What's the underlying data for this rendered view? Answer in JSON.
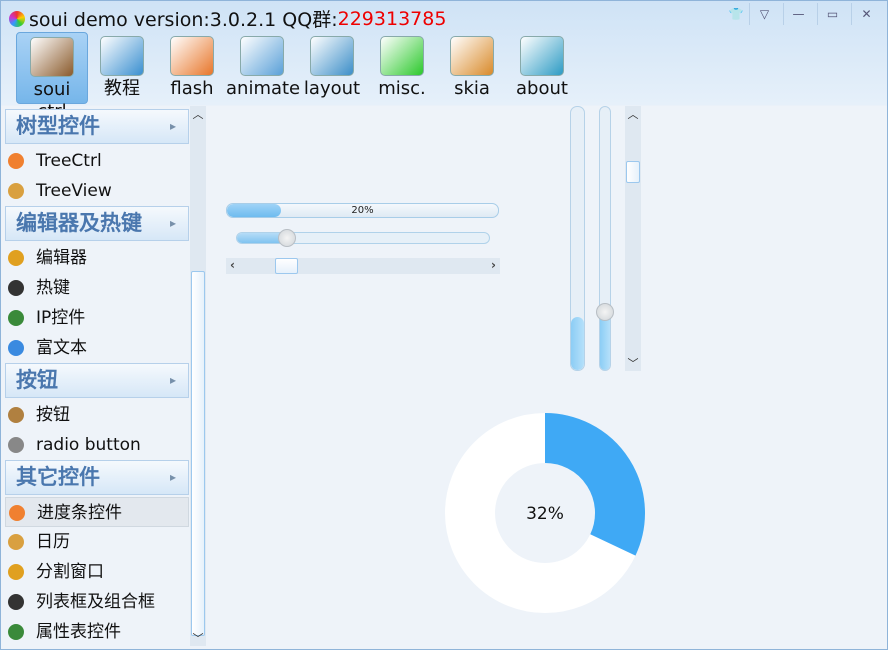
{
  "window": {
    "title": "soui demo version:3.0.2.1 QQ群:",
    "qq": "229313785",
    "controls": [
      "skin-icon",
      "menu-icon",
      "minimize-icon",
      "maximize-icon",
      "close-icon"
    ]
  },
  "toolbar": [
    {
      "label": "soui ctrl",
      "icon": "house-icon",
      "selected": true,
      "color": "#8a5a2b"
    },
    {
      "label": "教程",
      "icon": "cd-icon",
      "color": "#3a8fd0"
    },
    {
      "label": "flash",
      "icon": "flash-icon",
      "color": "#e8762a"
    },
    {
      "label": "animate",
      "icon": "news-icon",
      "color": "#5aa0d8"
    },
    {
      "label": "layout",
      "icon": "layout-icon",
      "color": "#3c8ec8"
    },
    {
      "label": "misc.",
      "icon": "misc-icon",
      "color": "#2cc92c"
    },
    {
      "label": "skia",
      "icon": "skia-icon",
      "color": "#d98a2a"
    },
    {
      "label": "about",
      "icon": "headphone-icon",
      "color": "#2d9bc4"
    }
  ],
  "sidebar": {
    "groups": [
      {
        "label": "树型控件",
        "items": [
          {
            "label": "TreeCtrl",
            "icon": "star-icon"
          },
          {
            "label": "TreeView",
            "icon": "brush-icon"
          }
        ]
      },
      {
        "label": "编辑器及热键",
        "items": [
          {
            "label": "编辑器",
            "icon": "broom-icon"
          },
          {
            "label": "热键",
            "icon": "panda-icon"
          },
          {
            "label": "IP控件",
            "icon": "cactus-icon"
          },
          {
            "label": "富文本",
            "icon": "globe-icon"
          }
        ]
      },
      {
        "label": "按钮",
        "items": [
          {
            "label": "按钮",
            "icon": "tree-icon"
          },
          {
            "label": "radio button",
            "icon": "face-icon"
          }
        ]
      },
      {
        "label": "其它控件",
        "items": [
          {
            "label": "进度条控件",
            "icon": "star-icon",
            "selected": true
          },
          {
            "label": "日历",
            "icon": "brush-icon"
          },
          {
            "label": "分割窗口",
            "icon": "broom-icon"
          },
          {
            "label": "列表框及组合框",
            "icon": "panda-icon"
          },
          {
            "label": "属性表控件",
            "icon": "cactus-icon"
          }
        ]
      }
    ]
  },
  "main": {
    "progress_h": {
      "value": 20,
      "label": "20%"
    },
    "slider_h": {
      "value": 20
    },
    "scroll_h": {
      "position": 15
    },
    "progress_v": {
      "value": 20
    },
    "slider_v": {
      "value": 22
    },
    "scroll_v": {
      "position": 10
    },
    "donut": {
      "value": 32,
      "label": "32%",
      "fill_color": "#3fa9f5",
      "rest_color": "#ffffff"
    }
  }
}
